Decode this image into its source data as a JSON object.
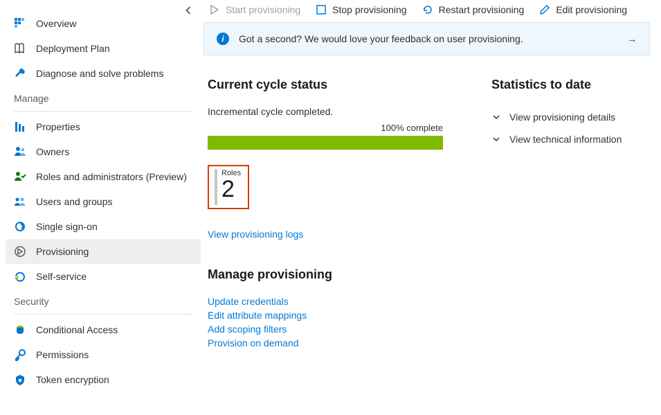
{
  "sidebar": {
    "top": [
      {
        "label": "Overview"
      },
      {
        "label": "Deployment Plan"
      },
      {
        "label": "Diagnose and solve problems"
      }
    ],
    "manage_heading": "Manage",
    "manage": [
      {
        "label": "Properties"
      },
      {
        "label": "Owners"
      },
      {
        "label": "Roles and administrators (Preview)"
      },
      {
        "label": "Users and groups"
      },
      {
        "label": "Single sign-on"
      },
      {
        "label": "Provisioning"
      },
      {
        "label": "Self-service"
      }
    ],
    "security_heading": "Security",
    "security": [
      {
        "label": "Conditional Access"
      },
      {
        "label": "Permissions"
      },
      {
        "label": "Token encryption"
      }
    ]
  },
  "toolbar": {
    "start": "Start provisioning",
    "stop": "Stop provisioning",
    "restart": "Restart provisioning",
    "edit": "Edit provisioning"
  },
  "feedback": {
    "text": "Got a second? We would love your feedback on user provisioning."
  },
  "cycle": {
    "title": "Current cycle status",
    "status": "Incremental cycle completed.",
    "progress_label": "100% complete",
    "roles_label": "Roles",
    "roles_count": "2",
    "logs_link": "View provisioning logs"
  },
  "manage_prov": {
    "title": "Manage provisioning",
    "links": {
      "creds": "Update credentials",
      "mappings": "Edit attribute mappings",
      "filters": "Add scoping filters",
      "demand": "Provision on demand"
    }
  },
  "stats": {
    "title": "Statistics to date",
    "details": "View provisioning details",
    "technical": "View technical information"
  }
}
